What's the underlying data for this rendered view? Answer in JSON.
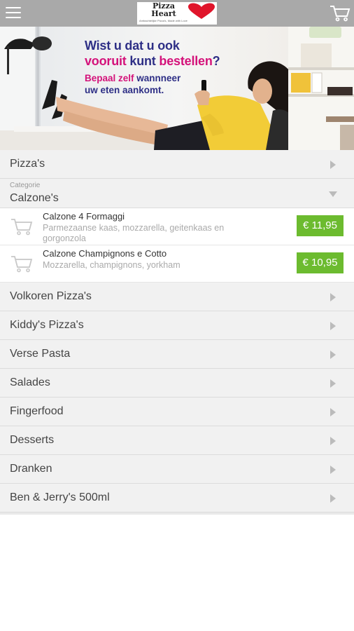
{
  "header": {
    "logo_name": "Pizza Heart",
    "logo_sub": "Ambachtelijke Pizza's, Made with Love",
    "icons": [
      "menu-icon",
      "cart-icon",
      "heart-icon"
    ]
  },
  "banner": {
    "line1": "Wist u dat u ook",
    "line2_a": "vooruit",
    "line2_b": " kunt ",
    "line2_c": "bestellen",
    "line2_d": "?",
    "line3_a": "Bepaal zelf",
    "line3_b": " wannneer",
    "line4": "uw eten aankomt."
  },
  "categories": {
    "c0": "Pizza's",
    "open_small": "Categorie",
    "open_label": "Calzone's",
    "c2": "Volkoren Pizza's",
    "c3": "Kiddy's Pizza's",
    "c4": "Verse Pasta",
    "c5": "Salades",
    "c6": "Fingerfood",
    "c7": "Desserts",
    "c8": "Dranken",
    "c9": "Ben & Jerry's 500ml"
  },
  "items": [
    {
      "name": "Calzone 4 Formaggi",
      "desc": "Parmezaanse kaas, mozzarella, geitenkaas en gorgonzola",
      "price": "€ 11,95"
    },
    {
      "name": "Calzone Champignons e Cotto",
      "desc": "Mozzarella, champignons, yorkham",
      "price": "€ 10,95"
    }
  ],
  "colors": {
    "topbar": "#a9a9a9",
    "price_green": "#6cbb2f",
    "banner_navy": "#2e2f86",
    "banner_pink": "#d4127a",
    "heart_red": "#e0152b"
  }
}
